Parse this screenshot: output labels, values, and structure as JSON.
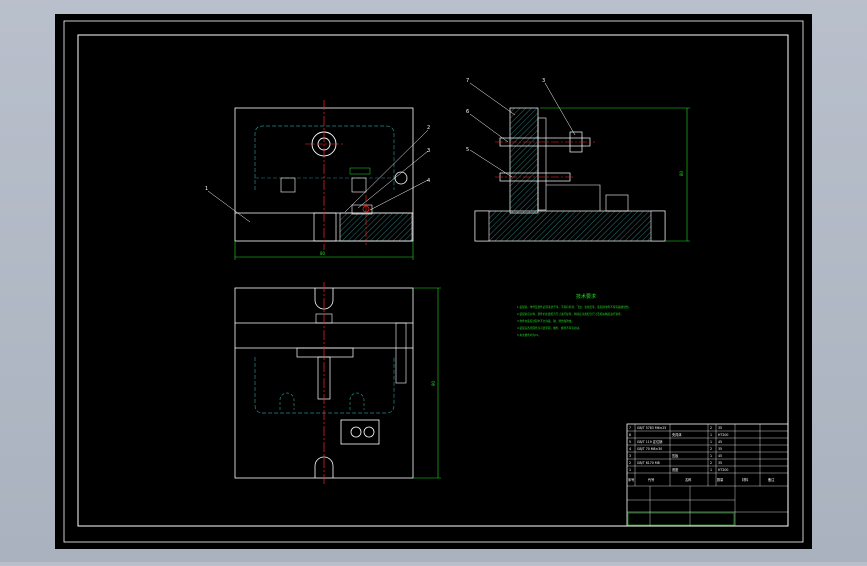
{
  "drawing": {
    "background_color": "#000000",
    "line_color": "#ffffff",
    "center_line_color": "#ff2222",
    "dim_color": "#22dd22",
    "hidden_line_color": "#2a8a8a"
  },
  "balloons": {
    "front": [
      "1",
      "2",
      "3",
      "4"
    ],
    "side": [
      "7",
      "6",
      "5",
      "3"
    ]
  },
  "dimensions": {
    "front_width": "80",
    "side_height": "80",
    "top_height": "90"
  },
  "tech_req": {
    "title": "技术要求",
    "lines": [
      "1.装配前，零件及部件必须清洗干净，不得有毛刺、飞边、氧化皮等，装配前零件不得有磕碰划伤。",
      "2.装配前应对零、部件的主要配合尺寸进行复查，特别是过盈配合尺寸及相关精度进行复查。",
      "3.零件在装配过程中不允许磕、碰、划伤和锈蚀。",
      "4.装配后各紧固件应可靠紧固，螺栓、螺母不得有松动。",
      "5.未注倒角均为C1。"
    ]
  },
  "bom": {
    "rows": [
      [
        "7",
        "GB/T 5783 M6×25",
        "",
        "2",
        "35"
      ],
      [
        "6",
        "夹具体",
        "",
        "1",
        "HT200"
      ],
      [
        "5",
        "GB/T 119 定位销",
        "",
        "1",
        "45"
      ],
      [
        "4",
        "GB/T 70 M8×30",
        "",
        "2",
        "35"
      ],
      [
        "3",
        "压板",
        "",
        "1",
        "45"
      ],
      [
        "2",
        "GB/T 6170 M8",
        "",
        "2",
        "35"
      ],
      [
        "1",
        "底座",
        "",
        "1",
        "HT200"
      ]
    ],
    "header": [
      "序号",
      "代号",
      "名称",
      "数量",
      "材料",
      "备注"
    ]
  }
}
